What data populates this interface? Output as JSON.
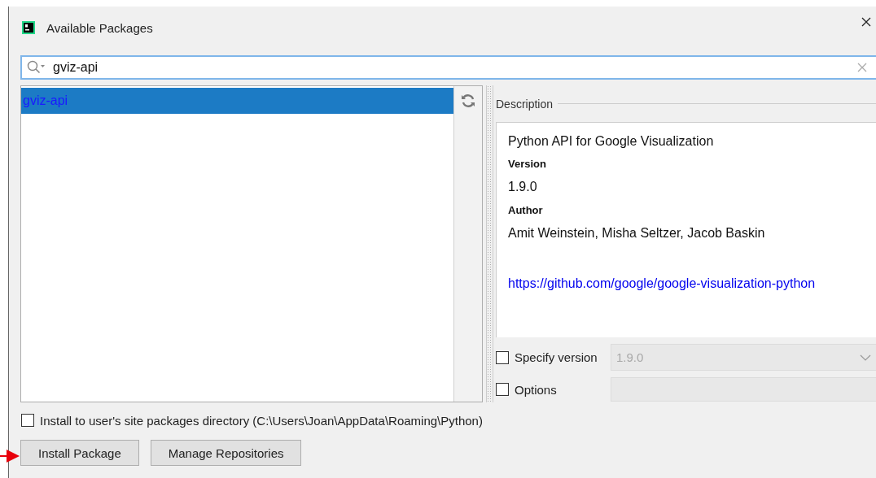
{
  "window": {
    "title": "Available Packages"
  },
  "search": {
    "value": "gviz-api"
  },
  "packages": [
    {
      "name": "gviz-api",
      "selected": true
    }
  ],
  "description": {
    "label": "Description",
    "summary": "Python API for Google Visualization",
    "fields": [
      {
        "label": "Version",
        "value": "1.9.0"
      },
      {
        "label": "Author",
        "value": "Amit Weinstein, Misha Seltzer, Jacob Baskin"
      }
    ],
    "link": "https://github.com/google/google-visualization-python"
  },
  "options": [
    {
      "kind": "dropdown",
      "label": "Specify version",
      "checked": false,
      "value": "1.9.0",
      "disabled": true
    },
    {
      "kind": "text",
      "label": "Options",
      "checked": false,
      "disabled": true
    }
  ],
  "user_site": {
    "label": "Install to user's site packages directory (C:\\Users\\Joan\\AppData\\Roaming\\Python)",
    "checked": false
  },
  "buttons": [
    "Install Package",
    "Manage Repositories"
  ]
}
